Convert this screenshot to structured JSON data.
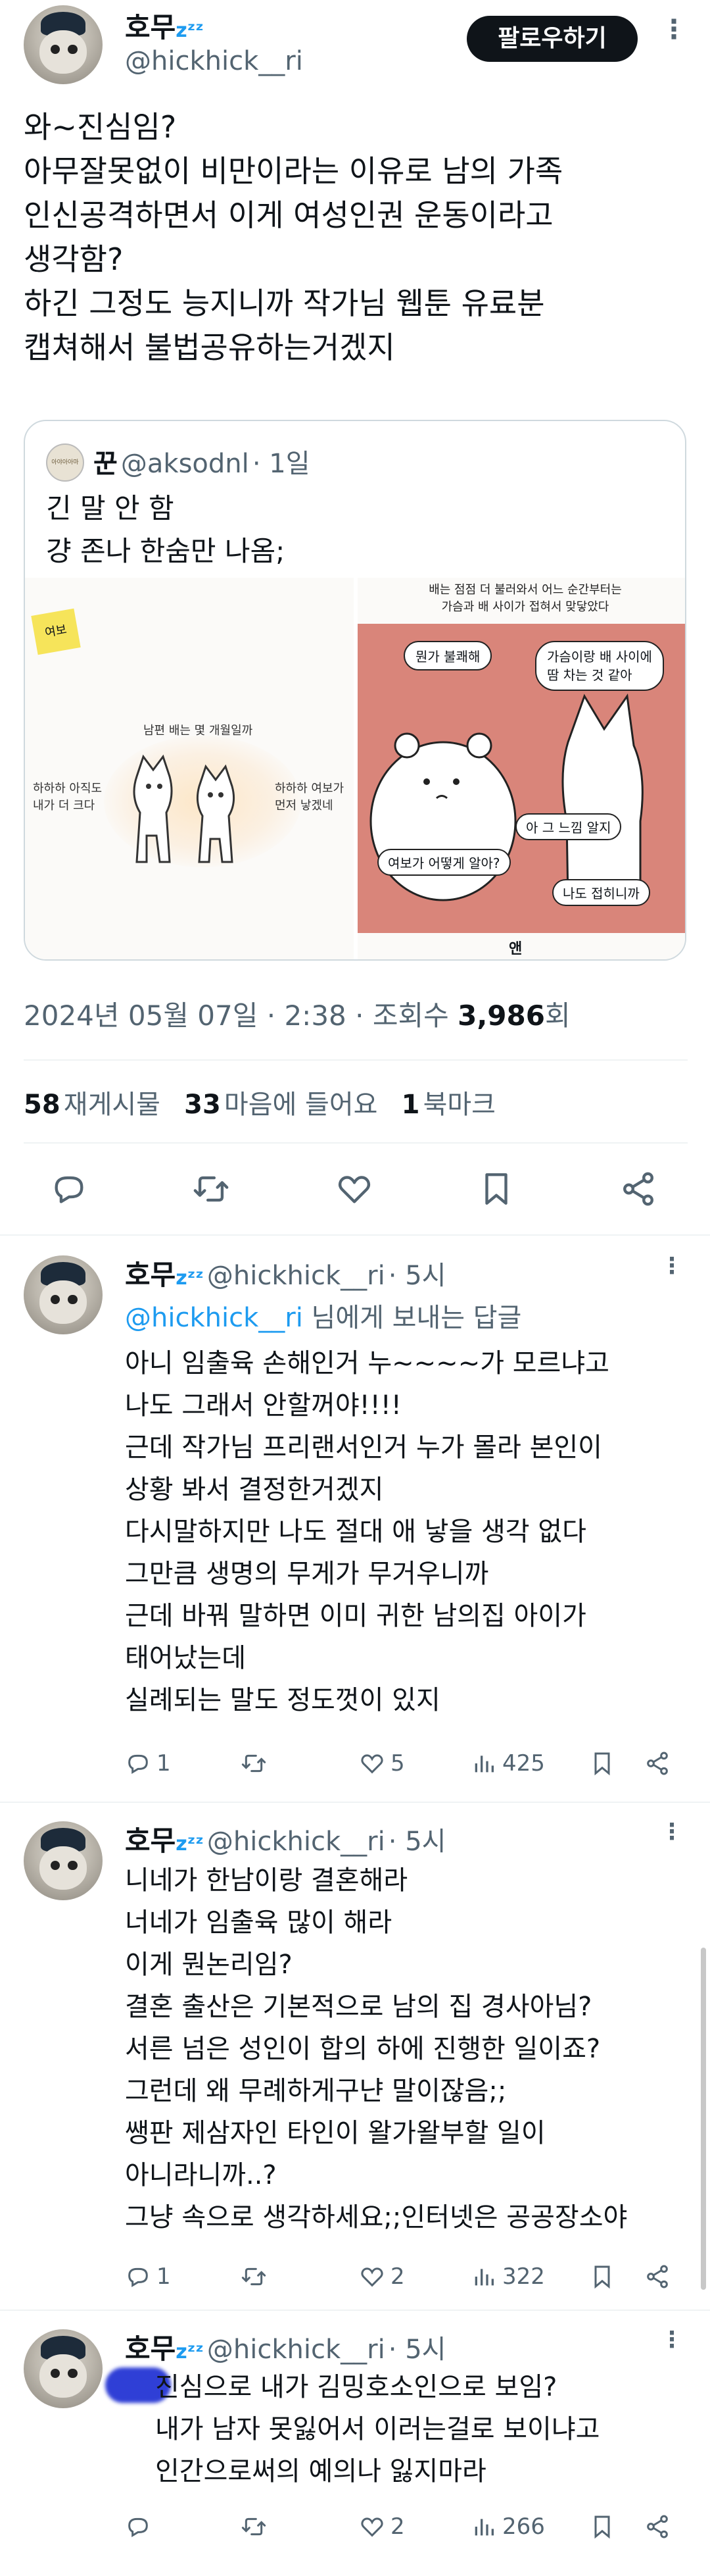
{
  "main_tweet": {
    "author": {
      "name": "호무",
      "zzz": "zᶻᶻ",
      "handle": "@hickhick__ri"
    },
    "follow_label": "팔로우하기",
    "text": "와~진심임?\n아무잘못없이 비만이라는 이유로 남의 가족\n인신공격하면서 이게 여성인권 운동이라고\n생각함?\n하긴 그정도 능지니까 작가님 웹툰 유료분\n캡쳐해서 불법공유하는거겠지",
    "quote": {
      "avatar_label": "아야아아마",
      "name": "꾼",
      "handle": "@aksodnl",
      "time": "· 1일",
      "text": "긴 말 안 함\n걍 존나 한숨만 나옴;",
      "image_left": {
        "sticky_note": "여보",
        "caption_top": "남편 배는 몇 개월일까",
        "left_speech": "하하하 아직도\n내가 더 크다",
        "right_speech": "하하하 여보가\n먼저 낳겠네"
      },
      "image_right": {
        "narration": "배는 점점 더 불러와서 어느 순간부터는\n가슴과 배 사이가 접혀서 맞닿았다",
        "bubble_1": "뭔가 불쾌해",
        "bubble_2": "가슴이랑 배 사이에\n땀 차는 것 같아",
        "bubble_3": "아 그 느낌 알지",
        "bubble_4": "여보가 어떻게 알아?",
        "bubble_5": "나도 접히니까",
        "footer": "앤"
      }
    },
    "timestamp": "2024년 05월 07일 · 2:38 · 조회수",
    "views": "3,986",
    "views_suffix": "회",
    "stats": {
      "retweets": "58",
      "retweets_label": "재게시물",
      "likes": "33",
      "likes_label": "마음에 들어요",
      "bookmarks": "1",
      "bookmarks_label": "북마크"
    }
  },
  "replies": [
    {
      "name": "호무",
      "zzz": "zᶻᶻ",
      "handle": "@hickhick__ri",
      "time": "· 5시",
      "reply_to_mention": "@hickhick__ri",
      "reply_to_suffix": " 님에게 보내는 답글",
      "text": "아니 임출육 손해인거 누~~~~가 모르냐고\n나도 그래서 안할꺼야!!!!\n근데 작가님 프리랜서인거 누가 몰라 본인이\n상황 봐서 결정한거겠지\n다시말하지만 나도 절대 애 낳을 생각 없다\n그만큼 생명의 무게가 무거우니까\n근데 바꿔 말하면 이미 귀한 남의집 아이가\n태어났는데\n실례되는 말도 정도껏이 있지",
      "replies": "1",
      "retweets": "",
      "likes": "5",
      "views": "425"
    },
    {
      "name": "호무",
      "zzz": "zᶻᶻ",
      "handle": "@hickhick__ri",
      "time": "· 5시",
      "text": "니네가 한남이랑 결혼해라\n너네가 임출육 많이 해라\n이게 뭔논리임?\n결혼 출산은 기본적으로 남의 집 경사아님?\n서른 넘은 성인이 합의 하에 진행한 일이죠?\n그런데 왜 무례하게구냔 말이잖음;;\n쌩판 제삼자인 타인이 왈가왈부할 일이\n아니라니까..?\n그냥 속으로 생각하세요;;인터넷은 공공장소야",
      "replies": "1",
      "retweets": "",
      "likes": "2",
      "views": "322"
    },
    {
      "name": "호무",
      "zzz": "zᶻᶻ",
      "handle": "@hickhick__ri",
      "time": "· 5시",
      "text": "진심으로 내가 김밍호소인으로 보임?\n내가 남자 못잃어서 이러는걸로 보이냐고\n인간으로써의 예의나 잃지마라",
      "replies": "",
      "retweets": "",
      "likes": "2",
      "views": "266"
    }
  ],
  "colors": {
    "accent": "#1d9bf0",
    "text": "#0f1419",
    "secondary": "#536471",
    "border": "#cfd9de",
    "comic_bg": "#d9857a"
  },
  "icons": [
    "reply-icon",
    "retweet-icon",
    "like-icon",
    "bookmark-icon",
    "share-icon",
    "views-icon",
    "more-icon"
  ]
}
